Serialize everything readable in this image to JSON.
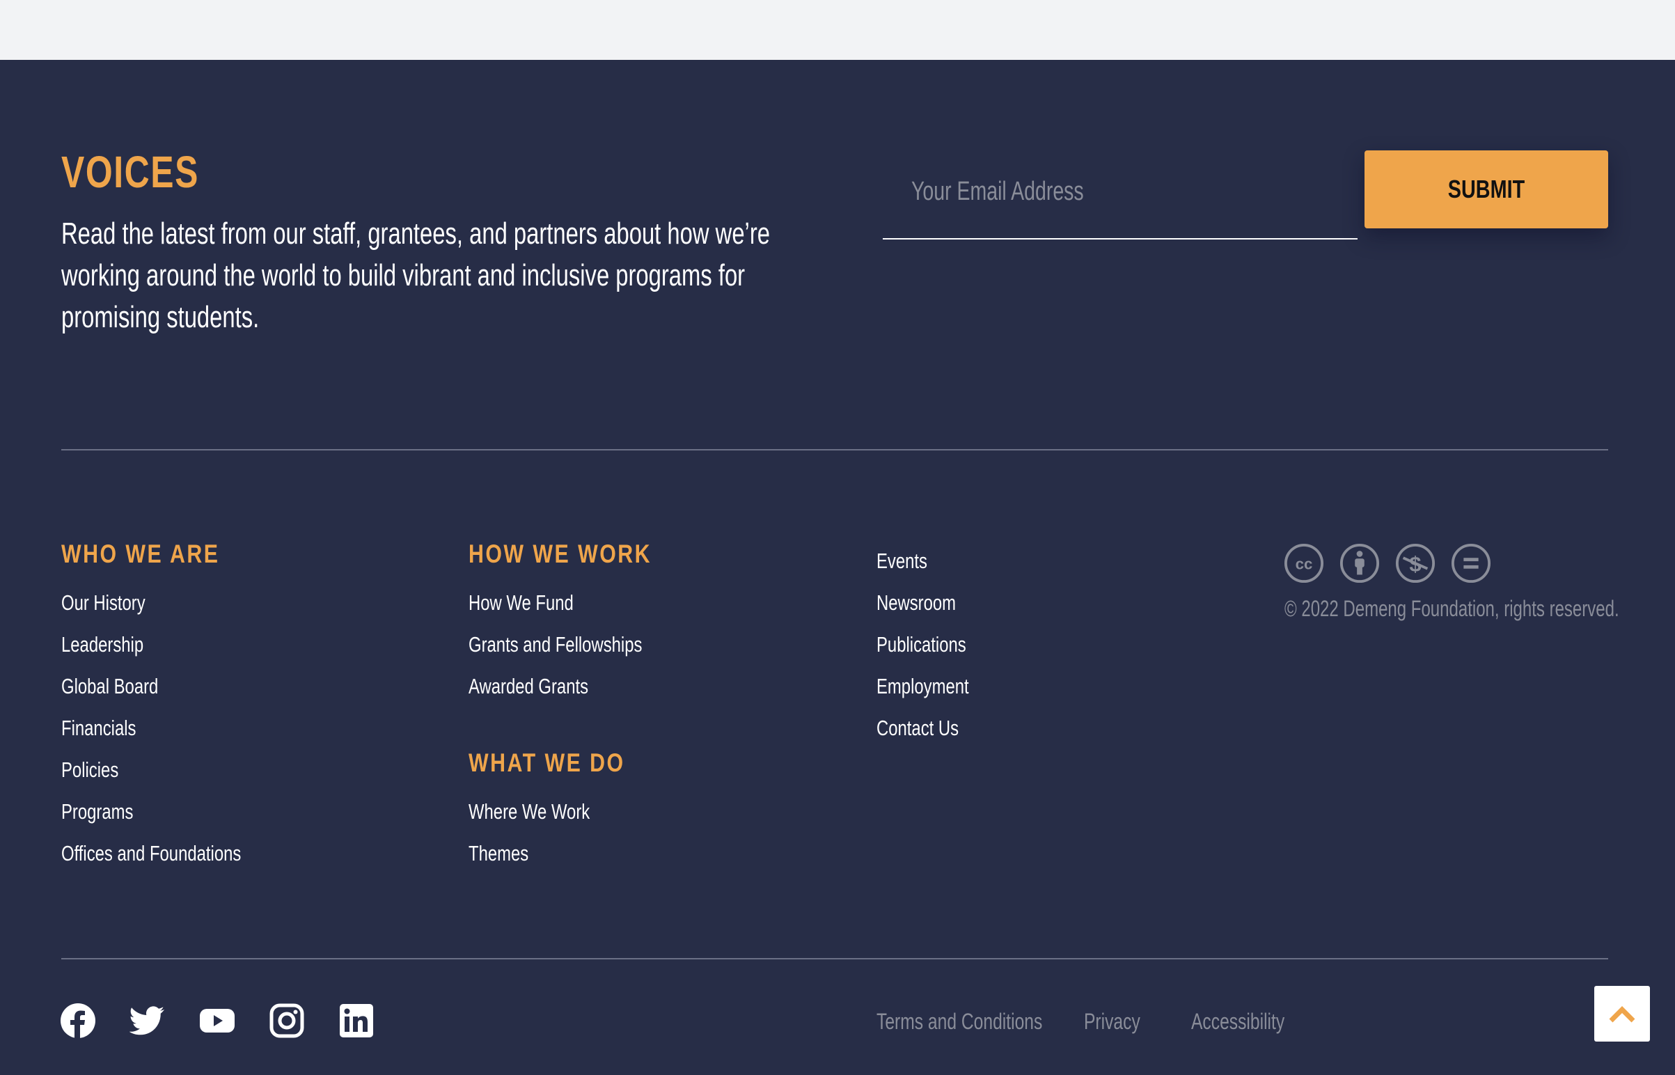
{
  "voices": {
    "title": "VOICES",
    "description": "Read the latest from our staff, grantees, and partners about how we’re working around the world to build vibrant and inclusive programs for promising students.",
    "email_placeholder": "Your Email Address",
    "submit_label": "SUBMIT"
  },
  "columns": {
    "who_we_are": {
      "heading": "WHO WE ARE",
      "links": [
        "Our History",
        "Leadership",
        "Global Board",
        "Financials",
        "Policies",
        "Programs",
        "Offices and Foundations"
      ]
    },
    "how_we_work": {
      "heading": "HOW WE WORK",
      "links": [
        "How We Fund",
        "Grants and Fellowships",
        "Awarded Grants"
      ]
    },
    "what_we_do": {
      "heading": "WHAT WE DO",
      "links": [
        "Where We Work",
        "Themes"
      ]
    },
    "misc": {
      "links": [
        "Events",
        "Newsroom",
        "Publications",
        "Employment",
        "Contact Us"
      ]
    }
  },
  "license": {
    "icons": [
      "creative-commons-icon",
      "attribution-icon",
      "noncommercial-icon",
      "no-derivatives-icon"
    ],
    "copyright": "© 2022 Demeng Foundation, rights reserved."
  },
  "social": [
    "facebook-icon",
    "twitter-icon",
    "youtube-icon",
    "instagram-icon",
    "linkedin-icon"
  ],
  "legal": {
    "terms": "Terms and Conditions",
    "privacy": "Privacy",
    "accessibility": "Accessibility"
  },
  "colors": {
    "footer_bg": "#272d47",
    "accent": "#efa54b",
    "muted": "#8a8d99"
  }
}
